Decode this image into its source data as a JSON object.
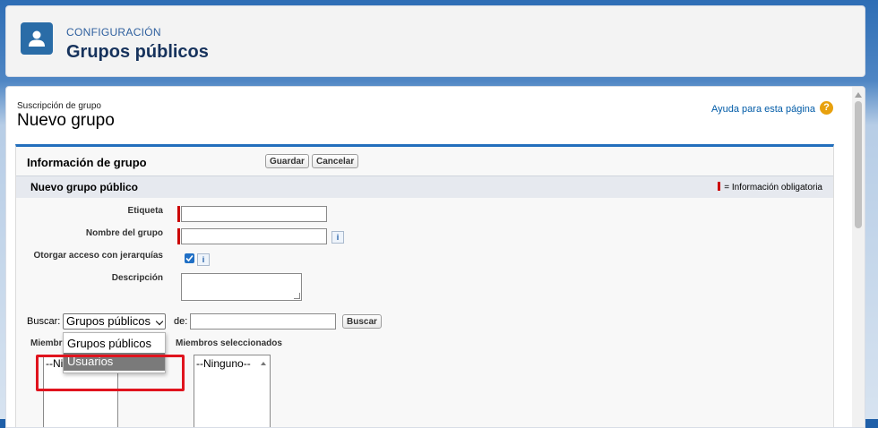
{
  "header": {
    "eyebrow": "CONFIGURACIÓN",
    "title": "Grupos públicos",
    "icon": "user-icon"
  },
  "page": {
    "eyebrow": "Suscripción de grupo",
    "title": "Nuevo grupo",
    "help_link": "Ayuda para esta página",
    "help_icon": "?"
  },
  "panel": {
    "title": "Información de grupo",
    "save_label": "Guardar",
    "cancel_label": "Cancelar",
    "section_title": "Nuevo grupo público",
    "required_legend": "= Información obligatoria"
  },
  "form": {
    "label_field": "Etiqueta",
    "label_value": "",
    "group_name_field": "Nombre del grupo",
    "group_name_value": "",
    "hierarchy_field": "Otorgar acceso con jerarquías",
    "hierarchy_checked": true,
    "description_field": "Descripción",
    "info_glyph": "i"
  },
  "search": {
    "label": "Buscar:",
    "selected": "Grupos públicos",
    "options": [
      "Grupos públicos",
      "Usuarios"
    ],
    "highlighted_option": "Usuarios",
    "de_label": "de:",
    "query": "",
    "button": "Buscar"
  },
  "members": {
    "available_label": "Miembr",
    "available_placeholder": "--Ni",
    "selected_label": "Miembros seleccionados",
    "selected_placeholder": "--Ninguno--"
  },
  "colors": {
    "accent": "#236fbd",
    "required": "#c00000",
    "highlight_box": "#e0141e"
  }
}
